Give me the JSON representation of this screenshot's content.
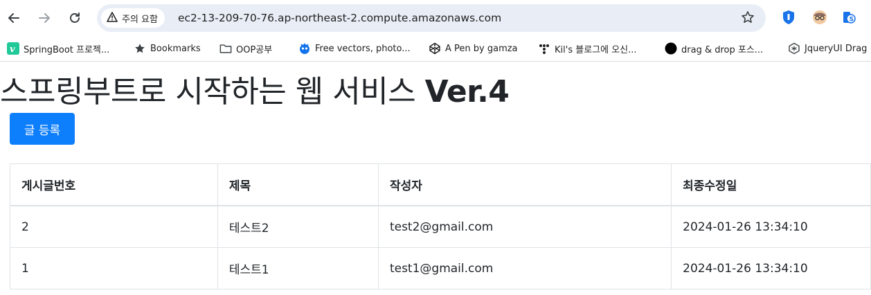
{
  "browser": {
    "security_label": "주의 요함",
    "url": "ec2-13-209-70-76.ap-northeast-2.compute.amazonaws.com"
  },
  "bookmarks": [
    {
      "label": "SpringBoot 프로젝..."
    },
    {
      "label": "Bookmarks"
    },
    {
      "label": "OOP공부"
    },
    {
      "label": "Free vectors, photo..."
    },
    {
      "label": "A Pen by gamza"
    },
    {
      "label": "Kil's 블로그에 오신..."
    },
    {
      "label": "drag & drop 포스..."
    },
    {
      "label": "JqueryUI Drag"
    }
  ],
  "page": {
    "title_main": "스프링부트로 시작하는 웹 서비스 ",
    "title_version": "Ver.4",
    "register_button": "글 등록"
  },
  "table": {
    "headers": [
      "게시글번호",
      "제목",
      "작성자",
      "최종수정일"
    ],
    "rows": [
      {
        "id": "2",
        "title": "테스트2",
        "author": "test2@gmail.com",
        "modified": "2024-01-26 13:34:10"
      },
      {
        "id": "1",
        "title": "테스트1",
        "author": "test1@gmail.com",
        "modified": "2024-01-26 13:34:10"
      }
    ]
  },
  "colors": {
    "primary": "#0d7efc",
    "omnibox": "#e9eef6"
  }
}
